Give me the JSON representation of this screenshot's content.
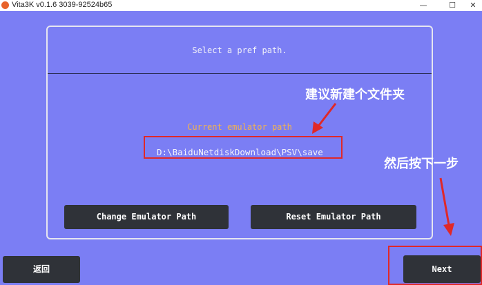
{
  "window": {
    "title": "Vita3K v0.1.6 3039-92524b65",
    "minimize_icon": "—",
    "maximize_icon": "☐",
    "close_icon": "✕"
  },
  "dialog": {
    "title": "Select a pref path.",
    "current_path_label": "Current emulator path",
    "current_path_value": "D:\\BaiduNetdiskDownload\\PSV\\save",
    "change_button": "Change Emulator Path",
    "reset_button": "Reset Emulator Path"
  },
  "navigation": {
    "back_button": "返回",
    "next_button": "Next"
  },
  "annotations": {
    "note_path": "建议新建个文件夹",
    "note_next": "然后按下一步",
    "color": "#e02828"
  },
  "colors": {
    "background": "#7b7ef4",
    "label_accent": "#f3b34e",
    "button": "#2f3238"
  }
}
